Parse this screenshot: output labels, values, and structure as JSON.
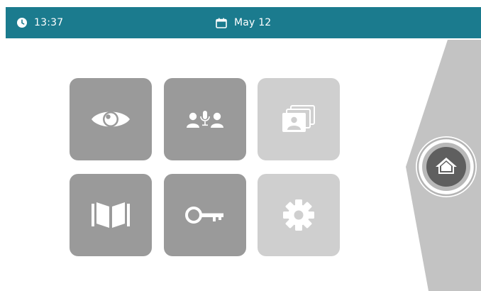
{
  "status_bar": {
    "time": "13:37",
    "date": "May 12",
    "icons": {
      "clock": "clock-icon",
      "calendar": "calendar-icon"
    }
  },
  "tiles": [
    {
      "id": "monitor",
      "icon": "eye-icon",
      "enabled": true
    },
    {
      "id": "intercom",
      "icon": "intercom-people-icon",
      "enabled": true
    },
    {
      "id": "gallery",
      "icon": "photo-gallery-icon",
      "enabled": false
    },
    {
      "id": "book",
      "icon": "book-icon",
      "enabled": true
    },
    {
      "id": "key",
      "icon": "key-icon",
      "enabled": true
    },
    {
      "id": "settings",
      "icon": "gear-icon",
      "enabled": false
    }
  ],
  "side_panel": {
    "home_icon": "home-icon"
  },
  "colors": {
    "top_bar": "#1b7b8e",
    "tile_active": "#9a9a9a",
    "tile_disabled": "#cfcfcf",
    "side_panel": "#c3c3c3",
    "home_button": "#616161"
  }
}
